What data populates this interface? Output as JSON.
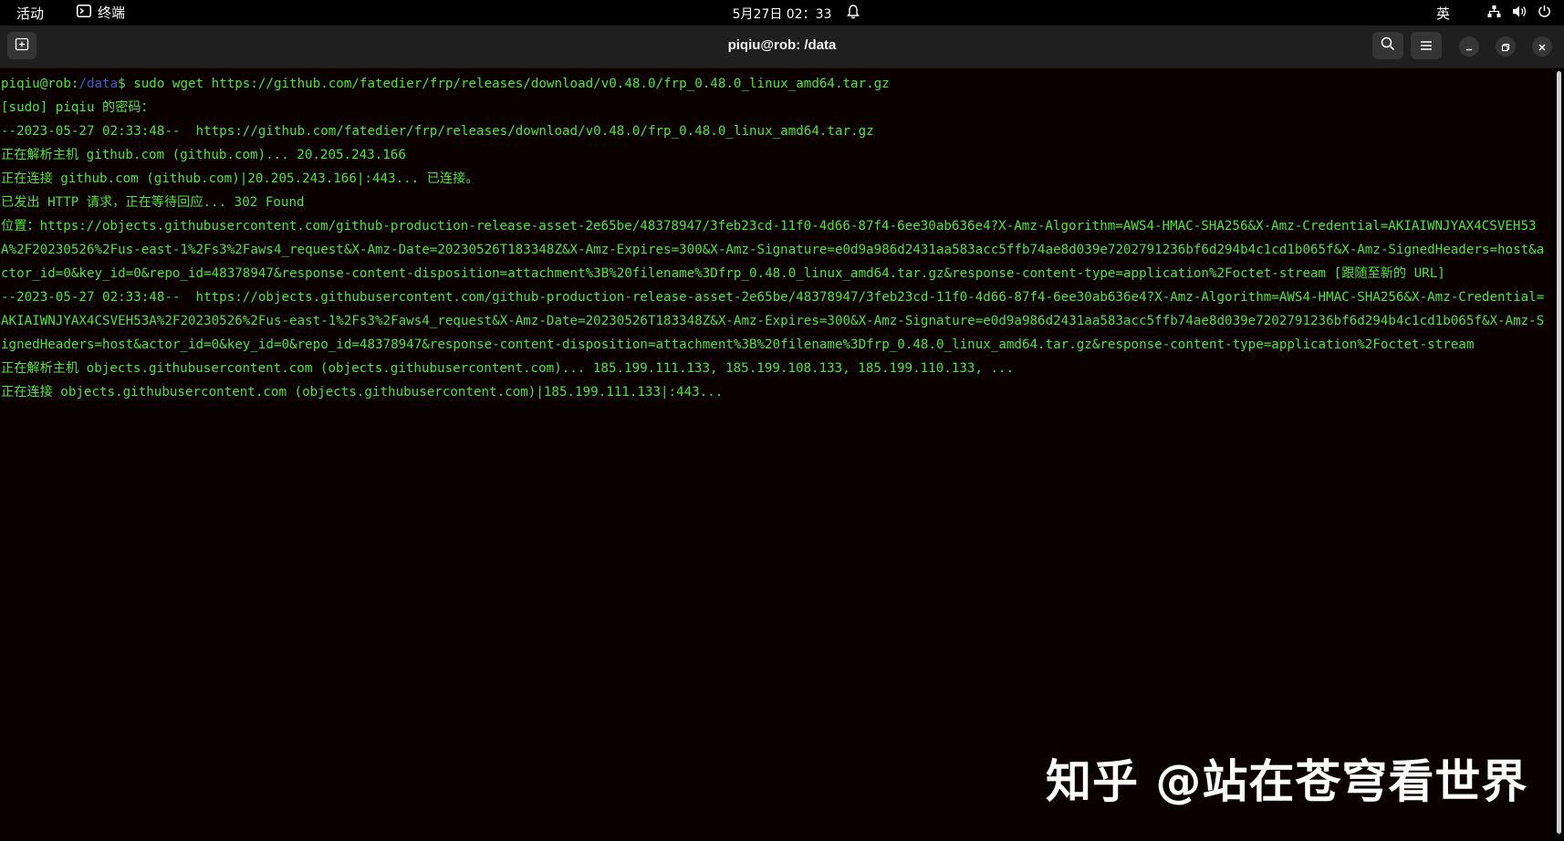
{
  "topbar": {
    "activities_label": "活动",
    "app_name": "终端",
    "clock": "5月27日 02：33",
    "input_method": "英"
  },
  "window": {
    "title": "piqiu@rob: /data"
  },
  "icons": {
    "new_tab": "new-tab-icon",
    "search": "search-icon",
    "menu": "hamburger-menu-icon",
    "minimize": "minimize-icon",
    "maximize": "maximize-icon",
    "close": "close-icon",
    "terminal": "terminal-icon",
    "bell": "bell-icon",
    "network": "network-icon",
    "volume": "volume-icon",
    "power": "power-icon"
  },
  "terminal": {
    "prompt_user": "piqiu@rob:",
    "prompt_path": "/data",
    "prompt_symbol": "$",
    "command": " sudo wget https://github.com/fatedier/frp/releases/download/v0.48.0/frp_0.48.0_linux_amd64.tar.gz",
    "lines": [
      "[sudo] piqiu 的密码：",
      "--2023-05-27 02:33:48--  https://github.com/fatedier/frp/releases/download/v0.48.0/frp_0.48.0_linux_amd64.tar.gz",
      "正在解析主机 github.com (github.com)... 20.205.243.166",
      "正在连接 github.com (github.com)|20.205.243.166|:443... 已连接。",
      "已发出 HTTP 请求，正在等待回应... 302 Found",
      "位置：https://objects.githubusercontent.com/github-production-release-asset-2e65be/48378947/3feb23cd-11f0-4d66-87f4-6ee30ab636e4?X-Amz-Algorithm=AWS4-HMAC-SHA256&X-Amz-Credential=AKIAIWNJYAX4CSVEH53A%2F20230526%2Fus-east-1%2Fs3%2Faws4_request&X-Amz-Date=20230526T183348Z&X-Amz-Expires=300&X-Amz-Signature=e0d9a986d2431aa583acc5ffb74ae8d039e7202791236bf6d294b4c1cd1b065f&X-Amz-SignedHeaders=host&actor_id=0&key_id=0&repo_id=48378947&response-content-disposition=attachment%3B%20filename%3Dfrp_0.48.0_linux_amd64.tar.gz&response-content-type=application%2Foctet-stream [跟随至新的 URL]",
      "--2023-05-27 02:33:48--  https://objects.githubusercontent.com/github-production-release-asset-2e65be/48378947/3feb23cd-11f0-4d66-87f4-6ee30ab636e4?X-Amz-Algorithm=AWS4-HMAC-SHA256&X-Amz-Credential=AKIAIWNJYAX4CSVEH53A%2F20230526%2Fus-east-1%2Fs3%2Faws4_request&X-Amz-Date=20230526T183348Z&X-Amz-Expires=300&X-Amz-Signature=e0d9a986d2431aa583acc5ffb74ae8d039e7202791236bf6d294b4c1cd1b065f&X-Amz-SignedHeaders=host&actor_id=0&key_id=0&repo_id=48378947&response-content-disposition=attachment%3B%20filename%3Dfrp_0.48.0_linux_amd64.tar.gz&response-content-type=application%2Foctet-stream",
      "正在解析主机 objects.githubusercontent.com (objects.githubusercontent.com)... 185.199.111.133, 185.199.108.133, 185.199.110.133, ...",
      "正在连接 objects.githubusercontent.com (objects.githubusercontent.com)|185.199.111.133|:443..."
    ]
  },
  "watermark": "知乎 @站在苍穹看世界",
  "colors": {
    "terminal_bg": "#0b0000",
    "terminal_fg": "#4de62e",
    "prompt_path": "#3a5fc8",
    "headerbar_bg": "#1f1f1f"
  }
}
